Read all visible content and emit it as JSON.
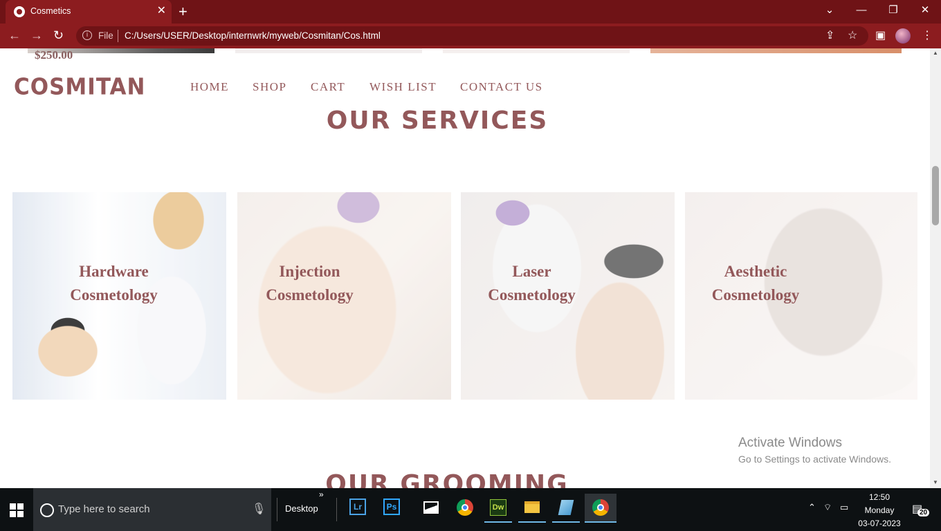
{
  "browser": {
    "tab_title": "Cosmetics",
    "tab_close": "✕",
    "new_tab": "+",
    "window_controls": [
      "⌄",
      "—",
      "❐",
      "✕"
    ],
    "address_prefix": "File",
    "url": "C:/Users/USER/Desktop/internwrk/myweb/Cosmitan/Cos.html"
  },
  "page": {
    "prev_price": "$250.00",
    "logo": "COSMITAN",
    "nav": [
      "HOME",
      "SHOP",
      "CART",
      "WISH LIST",
      "CONTACT US"
    ],
    "services_heading": "OUR SERVICES",
    "services": [
      {
        "line1": "Hardware",
        "line2": "Cosmetology"
      },
      {
        "line1": "Injection",
        "line2": "Cosmetology"
      },
      {
        "line1": "Laser",
        "line2": "Cosmetology"
      },
      {
        "line1": "Aesthetic",
        "line2": "Cosmetology"
      }
    ],
    "grooming_heading": "OUR GROOMING"
  },
  "watermark": {
    "line1": "Activate Windows",
    "line2": "Go to Settings to activate Windows."
  },
  "taskbar": {
    "search_placeholder": "Type here to search",
    "desktop_label": "Desktop",
    "apps": [
      "Lr",
      "Ps",
      "Photos",
      "Chrome",
      "Dw",
      "File Explorer",
      "Notepad",
      "Chrome"
    ],
    "time": "12:50",
    "day": "Monday",
    "date": "03-07-2023",
    "notification_count": "20"
  },
  "colors": {
    "chrome_dark": "#6f1316",
    "chrome_toolbar": "#8c1c1f",
    "brand": "#93585a"
  }
}
